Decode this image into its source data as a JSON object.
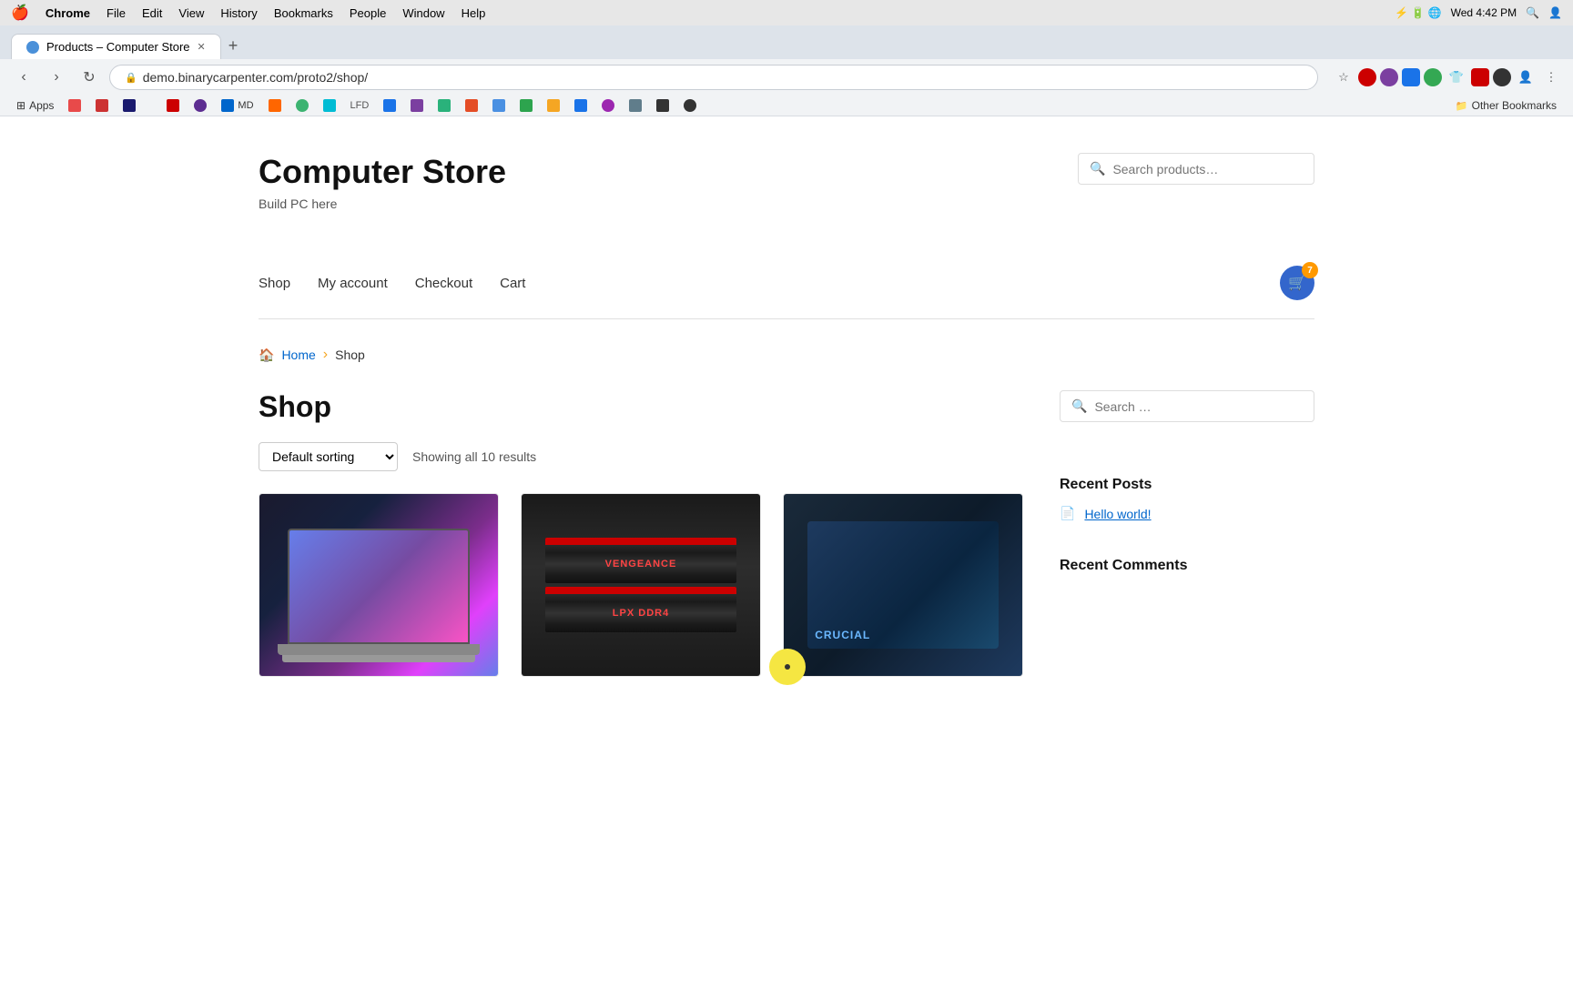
{
  "menubar": {
    "apple": "🍎",
    "items": [
      "Chrome",
      "File",
      "Edit",
      "View",
      "History",
      "Bookmarks",
      "People",
      "Window",
      "Help"
    ],
    "time": "Wed 4:42 PM",
    "battery": "100%"
  },
  "browser": {
    "tab_title": "Products – Computer Store",
    "url": "demo.binarycarpenter.com/proto2/shop/",
    "new_tab_label": "+"
  },
  "bookmarks": [
    {
      "label": "Apps",
      "color": "bm-blue"
    },
    {
      "label": "",
      "color": "bm-red"
    },
    {
      "label": "",
      "color": "bm-red"
    },
    {
      "label": "",
      "color": "bm-darkblue"
    },
    {
      "label": "",
      "color": "bm-red"
    },
    {
      "label": "",
      "color": "bm-purple"
    },
    {
      "label": "MD",
      "color": "bm-blue"
    },
    {
      "label": "",
      "color": "bm-orange"
    },
    {
      "label": "",
      "color": "bm-green"
    },
    {
      "label": "",
      "color": "bm-teal"
    },
    {
      "label": "LFD",
      "color": "bm-gray"
    },
    {
      "label": "",
      "color": "bm-blue"
    },
    {
      "label": "",
      "color": "bm-purple"
    },
    {
      "label": "",
      "color": "bm-green"
    },
    {
      "label": "",
      "color": "bm-red"
    },
    {
      "label": "",
      "color": "bm-blue"
    },
    {
      "label": "",
      "color": "bm-green"
    },
    {
      "label": "",
      "color": "bm-orange"
    },
    {
      "label": "",
      "color": "bm-blue"
    },
    {
      "label": "",
      "color": "bm-purple"
    }
  ],
  "other_bookmarks_label": "Other Bookmarks",
  "site": {
    "title": "Computer Store",
    "tagline": "Build PC here",
    "nav": {
      "shop": "Shop",
      "my_account": "My account",
      "checkout": "Checkout",
      "cart": "Cart"
    },
    "cart_count": "7",
    "breadcrumb": {
      "home": "Home",
      "separator": "›",
      "current": "Shop"
    },
    "shop_title": "Shop",
    "sort_label": "Default sorting",
    "results_text": "Showing all 10 results",
    "products": [
      {
        "name": "Laptop",
        "type": "laptop"
      },
      {
        "name": "Corsair Vengeance RAM",
        "type": "ram"
      },
      {
        "name": "Crucial SSD",
        "type": "ssd"
      }
    ]
  },
  "sidebar": {
    "search1": {
      "placeholder": "Search products…"
    },
    "search2": {
      "placeholder": "Search …"
    },
    "recent_posts_title": "Recent Posts",
    "posts": [
      {
        "label": "Hello world!"
      }
    ],
    "recent_comments_title": "Recent Comments"
  }
}
